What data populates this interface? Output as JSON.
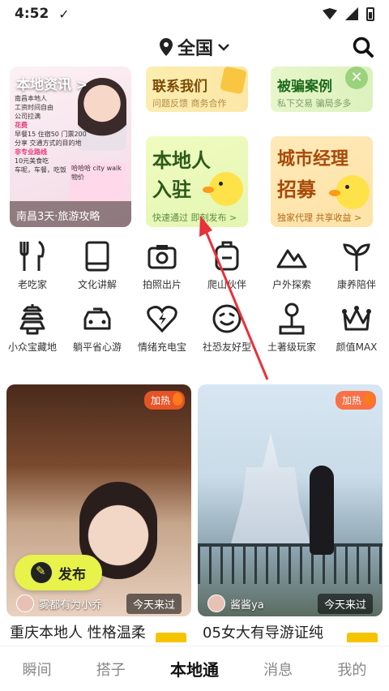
{
  "status": {
    "time": "4:52"
  },
  "header": {
    "city": "全国"
  },
  "info_card": {
    "title": "本地资讯 >",
    "caption": "南昌3天·旅游攻略",
    "notes": [
      "南昌本地人",
      "工资时间自由",
      "公司拉满",
      "花费",
      "早餐15 住宿50 门票200",
      "分享 交通方式的目的地",
      "哈哈哈 city walk",
      "非专业路线",
      "10元美食吃",
      "车呢，车餐，吃饭",
      "物价"
    ]
  },
  "tiles": {
    "contact": {
      "title": "联系我们",
      "sub": "问题反馈 商务合作"
    },
    "fraud": {
      "title": "被骗案例",
      "sub": "私下交易 骗局多多"
    },
    "join": {
      "title1": "本地人",
      "title2": "入驻",
      "sub": "快速通过 即刻发布 >"
    },
    "manager": {
      "title1": "城市经理",
      "title2": "招募",
      "sub": "独家代理 共享收益 >"
    }
  },
  "categories": [
    {
      "label": "老吃家",
      "icon": "fork-knife-icon"
    },
    {
      "label": "文化讲解",
      "icon": "book-icon"
    },
    {
      "label": "拍照出片",
      "icon": "camera-icon"
    },
    {
      "label": "爬山伙伴",
      "icon": "backpack-icon"
    },
    {
      "label": "户外探索",
      "icon": "mountain-icon"
    },
    {
      "label": "康养陪伴",
      "icon": "sprout-icon"
    },
    {
      "label": "小众宝藏地",
      "icon": "pagoda-icon"
    },
    {
      "label": "躺平省心游",
      "icon": "car-icon"
    },
    {
      "label": "情绪充电宝",
      "icon": "heart-bolt-icon"
    },
    {
      "label": "社恐友好型",
      "icon": "smile-icon"
    },
    {
      "label": "土著级玩家",
      "icon": "joystick-icon"
    },
    {
      "label": "颜值MAX",
      "icon": "crown-icon"
    }
  ],
  "feed": [
    {
      "hot": "加热",
      "author": "雾都有为小乔",
      "came": "今天来过",
      "title": "重庆本地人 性格温柔"
    },
    {
      "hot": "加热",
      "author": "酱酱ya",
      "came": "今天来过",
      "title": "05女大有导游证纯"
    }
  ],
  "publish": {
    "label": "发布"
  },
  "nav": [
    {
      "label": "瞬间"
    },
    {
      "label": "搭子"
    },
    {
      "label": "本地通",
      "active": true
    },
    {
      "label": "消息"
    },
    {
      "label": "我的"
    }
  ]
}
